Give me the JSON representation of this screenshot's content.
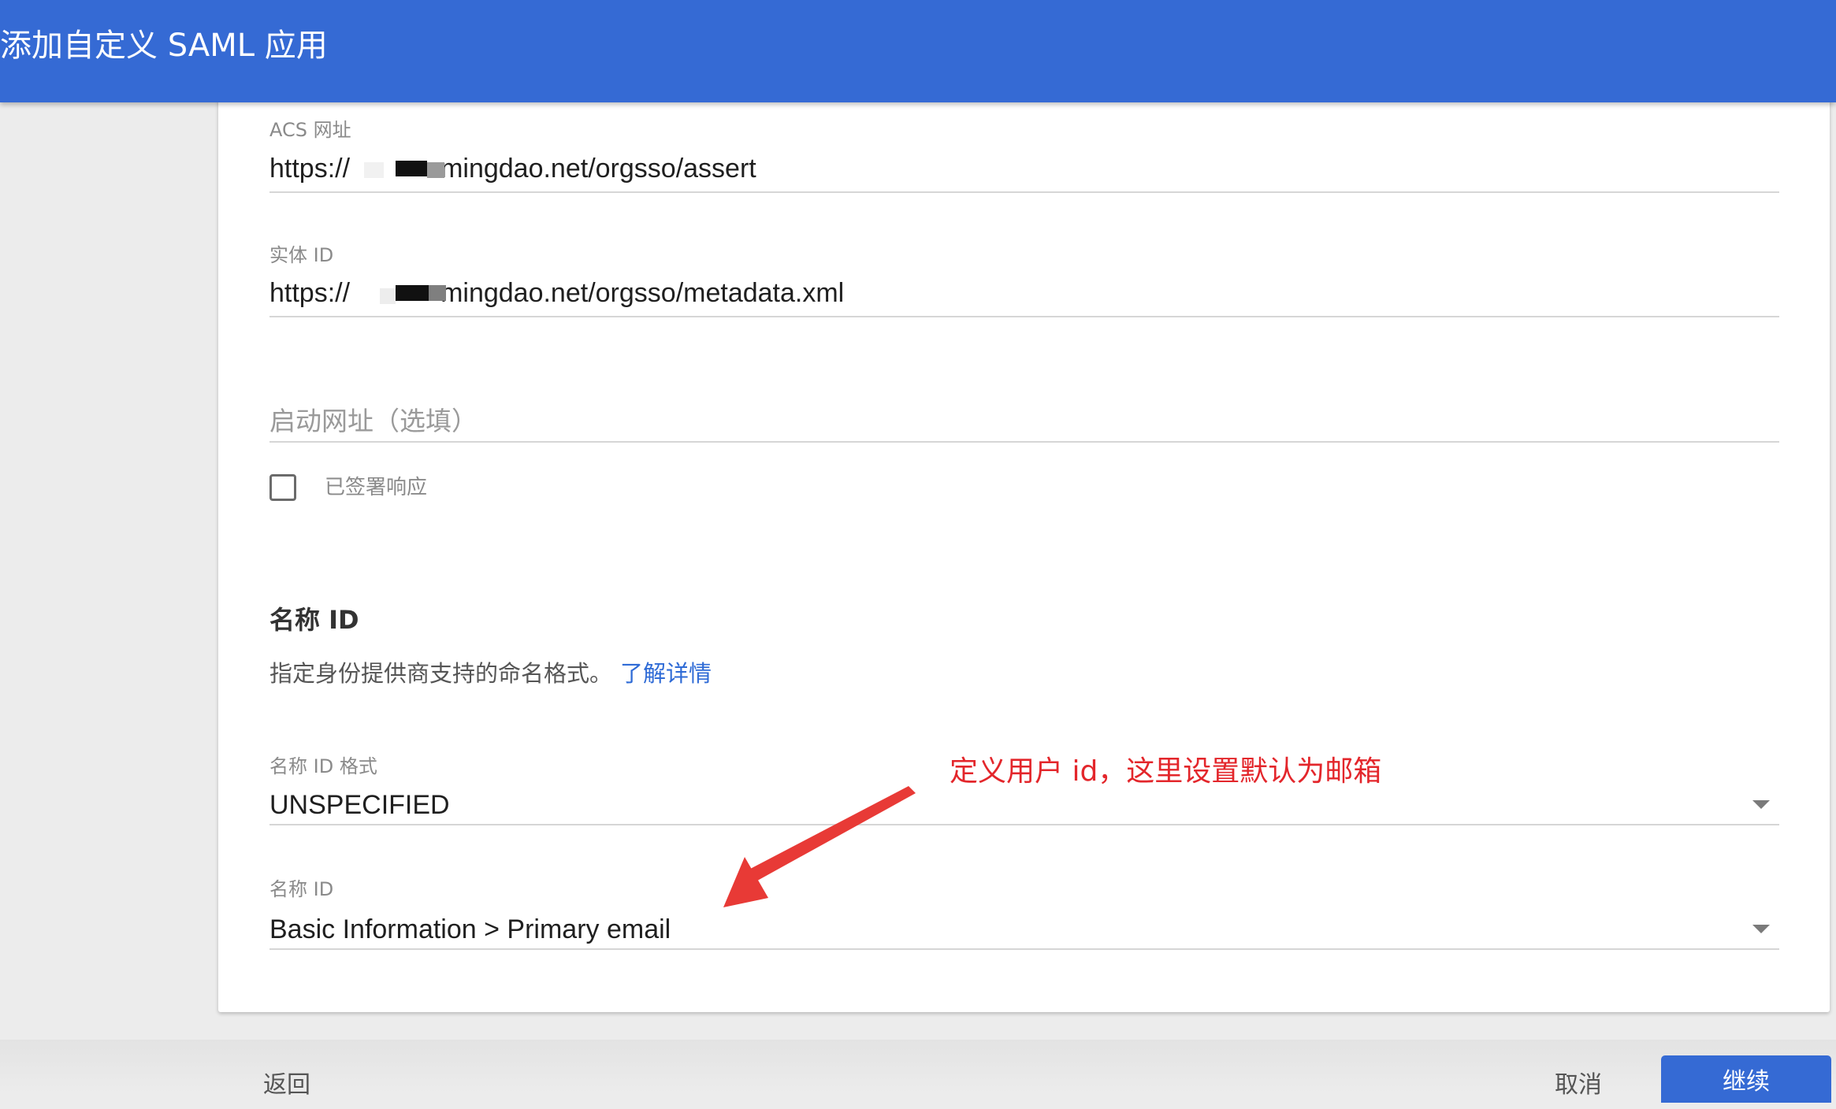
{
  "header": {
    "title": "添加自定义 SAML 应用"
  },
  "form": {
    "acs_url": {
      "label": "ACS 网址",
      "value_prefix": "https://",
      "value_suffix": "mingdao.net/orgsso/assert"
    },
    "entity_id": {
      "label": "实体 ID",
      "value_prefix": "https://",
      "value_suffix": "mingdao.net/orgsso/metadata.xml"
    },
    "start_url": {
      "placeholder": "启动网址（选填）"
    },
    "signed_response": {
      "label": "已签署响应",
      "checked": false
    }
  },
  "name_id_section": {
    "title": "名称 ID",
    "description": "指定身份提供商支持的命名格式。",
    "learn_more": "了解详情",
    "format": {
      "label": "名称 ID 格式",
      "value": "UNSPECIFIED"
    },
    "name_id": {
      "label": "名称 ID",
      "value": "Basic Information > Primary email"
    }
  },
  "annotation": {
    "text": "定义用户 id，这里设置默认为邮箱",
    "color": "#e3262b"
  },
  "footer": {
    "back_label": "返回",
    "cancel_label": "取消",
    "continue_label": "继续"
  },
  "colors": {
    "header_bg": "#356ad4",
    "link": "#2f6bd6",
    "primary_button": "#356ad4"
  }
}
